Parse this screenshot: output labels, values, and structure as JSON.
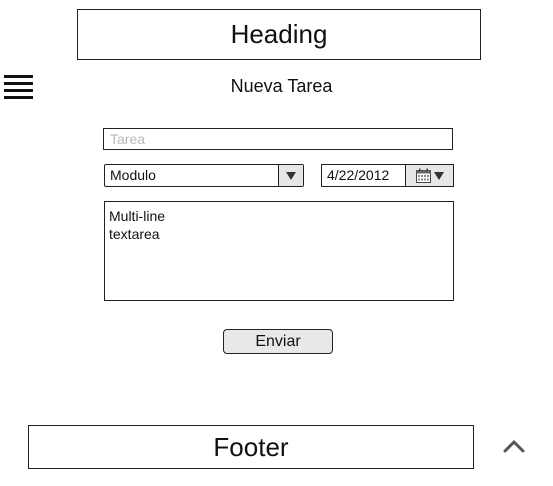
{
  "header": {
    "title": "Heading"
  },
  "nav": {
    "menu_icon": "hamburger-menu-icon"
  },
  "page": {
    "title": "Nueva Tarea"
  },
  "form": {
    "task": {
      "value": "",
      "placeholder": "Tarea"
    },
    "module": {
      "selected": "Modulo",
      "icon": "chevron-down-icon"
    },
    "date": {
      "value": "4/22/2012",
      "icon": "calendar-icon"
    },
    "notes": {
      "value": "Multi-line\ntextarea"
    },
    "submit_label": "Enviar"
  },
  "footer": {
    "title": "Footer"
  },
  "scroll_top": {
    "icon": "chevron-up-icon"
  }
}
